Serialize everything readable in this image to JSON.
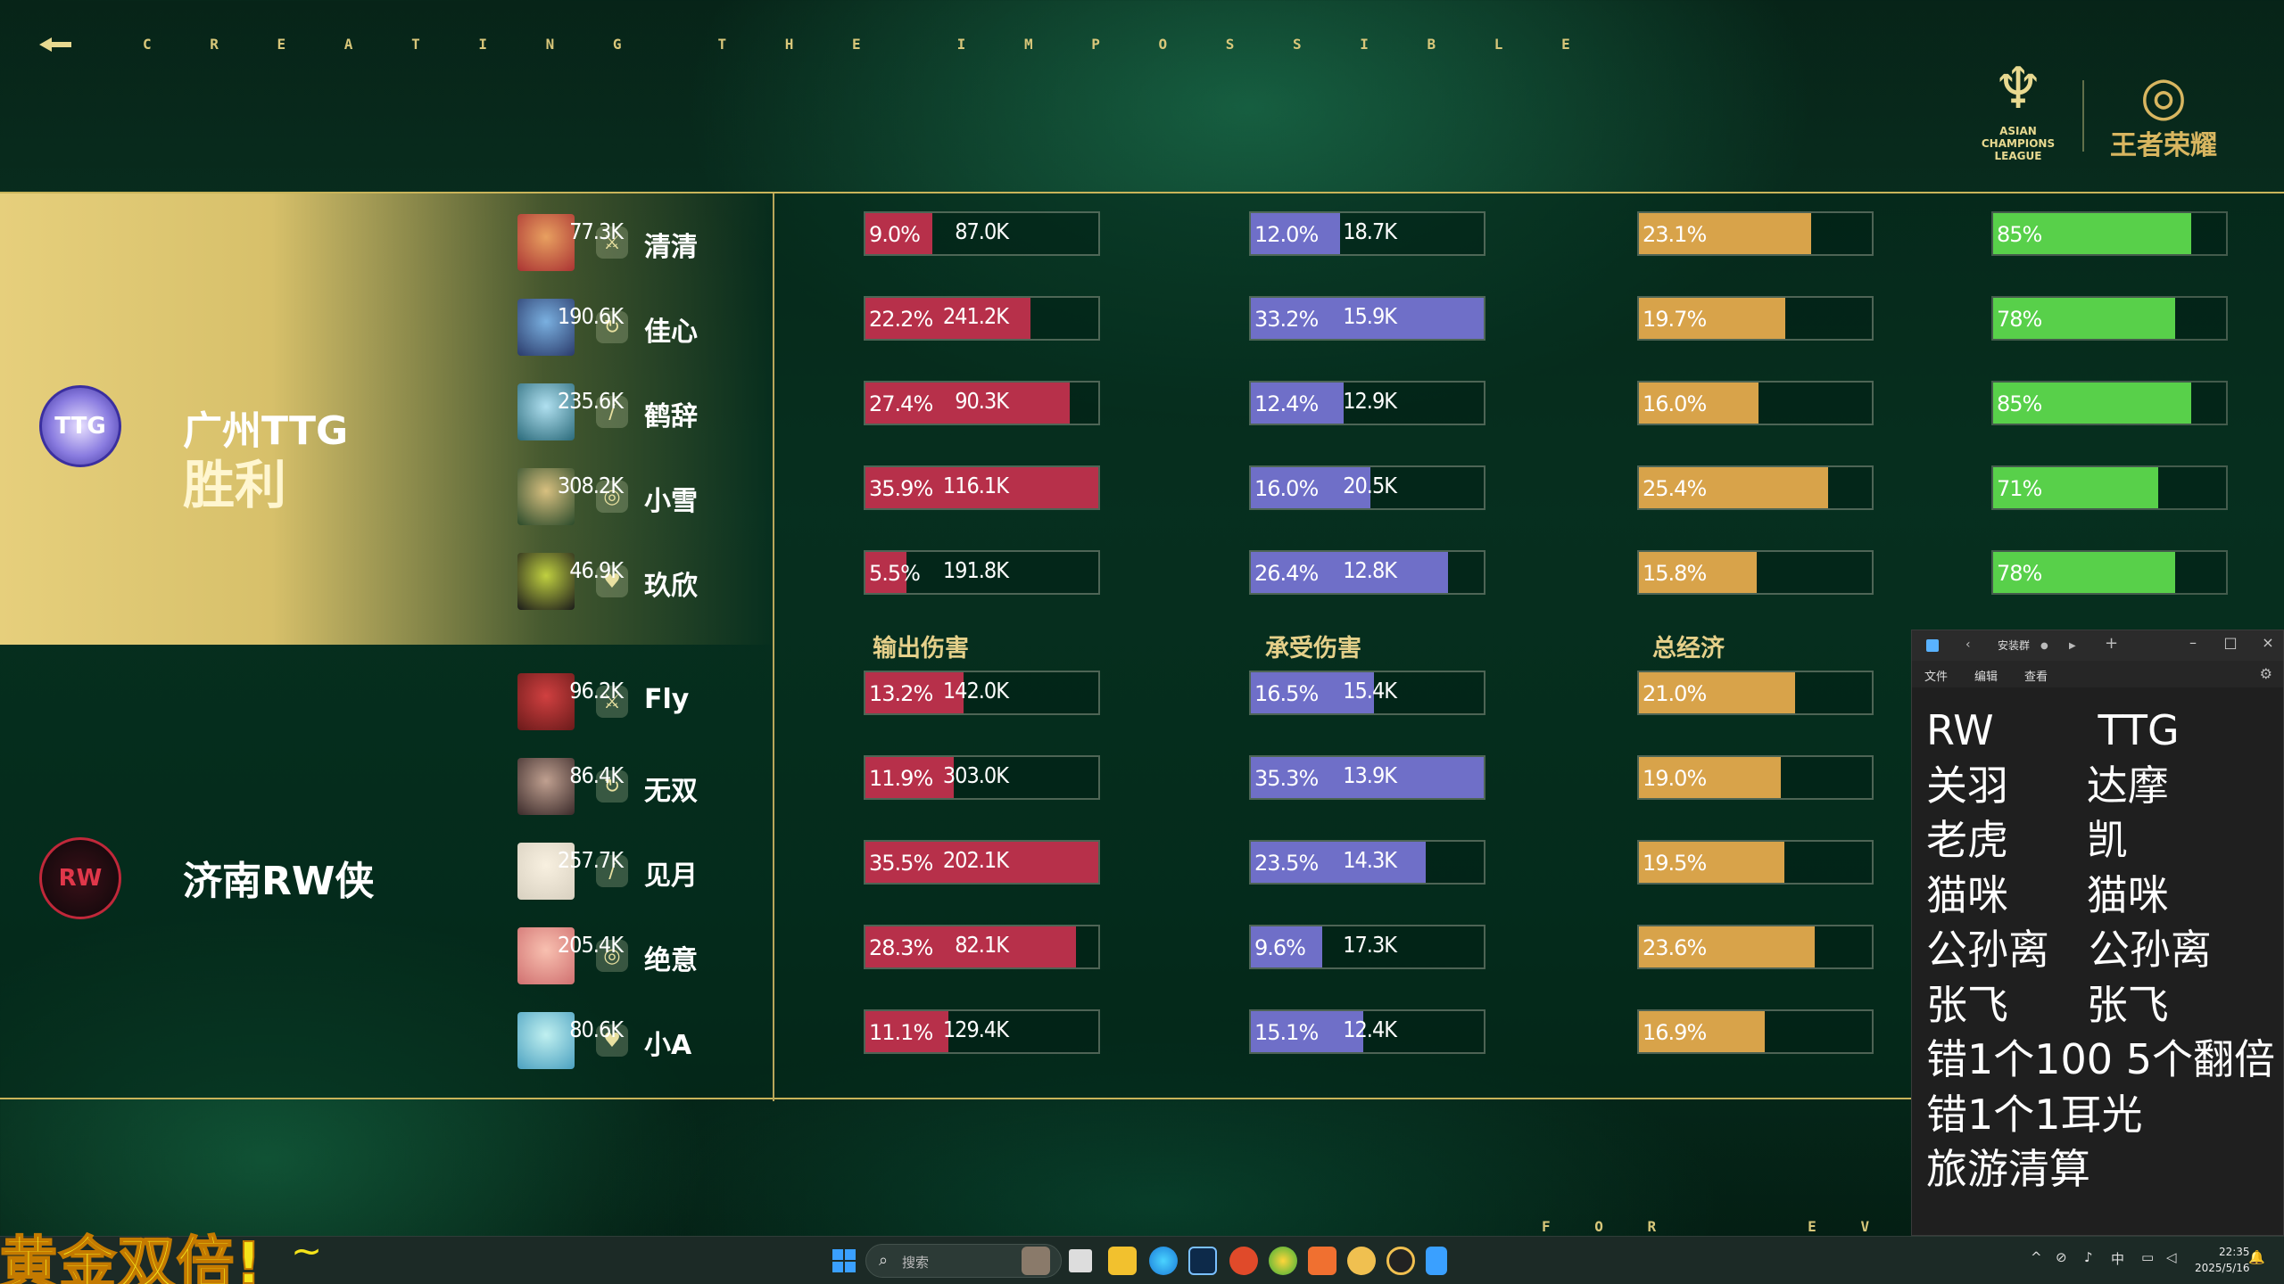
{
  "header": {
    "tagline": [
      "C R E A T I N G",
      "T H E",
      "I M P O S S I B L E"
    ],
    "league_logo_text": [
      "ASIAN",
      "CHAMPIONS",
      "LEAGUE"
    ],
    "game_logo_text": "王者荣耀"
  },
  "column_headers": {
    "damage_dealt": "输出伤害",
    "damage_taken": "承受伤害",
    "total_economy": "总经济"
  },
  "teams": [
    {
      "name": "广州TTG",
      "result": "胜利",
      "logo_text": "TTG",
      "color": "#5b4fbf",
      "players": [
        {
          "name": "清清",
          "role_icon": "jungle-icon",
          "dmg": "77.3K",
          "dmg_pct": "9.0%",
          "dmg_val": 9.0,
          "taken": "87.0K",
          "taken_pct": "12.0%",
          "taken_val": 12.0,
          "eco": "18.7K",
          "eco_pct": "23.1%",
          "eco_val": 23.1,
          "kp": "85%",
          "kp_val": 85
        },
        {
          "name": "佳心",
          "role_icon": "clash-icon",
          "dmg": "190.6K",
          "dmg_pct": "22.2%",
          "dmg_val": 22.2,
          "taken": "241.2K",
          "taken_pct": "33.2%",
          "taken_val": 33.2,
          "eco": "15.9K",
          "eco_pct": "19.7%",
          "eco_val": 19.7,
          "kp": "78%",
          "kp_val": 78
        },
        {
          "name": "鹤辞",
          "role_icon": "mid-icon",
          "dmg": "235.6K",
          "dmg_pct": "27.4%",
          "dmg_val": 27.4,
          "taken": "90.3K",
          "taken_pct": "12.4%",
          "taken_val": 12.4,
          "eco": "12.9K",
          "eco_pct": "16.0%",
          "eco_val": 16.0,
          "kp": "85%",
          "kp_val": 85
        },
        {
          "name": "小雪",
          "role_icon": "farm-icon",
          "dmg": "308.2K",
          "dmg_pct": "35.9%",
          "dmg_val": 35.9,
          "taken": "116.1K",
          "taken_pct": "16.0%",
          "taken_val": 16.0,
          "eco": "20.5K",
          "eco_pct": "25.4%",
          "eco_val": 25.4,
          "kp": "71%",
          "kp_val": 71
        },
        {
          "name": "玖欣",
          "role_icon": "support-icon",
          "dmg": "46.9K",
          "dmg_pct": "5.5%",
          "dmg_val": 5.5,
          "taken": "191.8K",
          "taken_pct": "26.4%",
          "taken_val": 26.4,
          "eco": "12.8K",
          "eco_pct": "15.8%",
          "eco_val": 15.8,
          "kp": "78%",
          "kp_val": 78
        }
      ]
    },
    {
      "name": "济南RW侠",
      "result": "",
      "logo_text": "RW",
      "color": "#c0283a",
      "players": [
        {
          "name": "Fly",
          "role_icon": "jungle-icon",
          "dmg": "96.2K",
          "dmg_pct": "13.2%",
          "dmg_val": 13.2,
          "taken": "142.0K",
          "taken_pct": "16.5%",
          "taken_val": 16.5,
          "eco": "15.4K",
          "eco_pct": "21.0%",
          "eco_val": 21.0
        },
        {
          "name": "无双",
          "role_icon": "clash-icon",
          "dmg": "86.4K",
          "dmg_pct": "11.9%",
          "dmg_val": 11.9,
          "taken": "303.0K",
          "taken_pct": "35.3%",
          "taken_val": 35.3,
          "eco": "13.9K",
          "eco_pct": "19.0%",
          "eco_val": 19.0
        },
        {
          "name": "见月",
          "role_icon": "mid-icon",
          "dmg": "257.7K",
          "dmg_pct": "35.5%",
          "dmg_val": 35.5,
          "taken": "202.1K",
          "taken_pct": "23.5%",
          "taken_val": 23.5,
          "eco": "14.3K",
          "eco_pct": "19.5%",
          "eco_val": 19.5
        },
        {
          "name": "绝意",
          "role_icon": "farm-icon",
          "dmg": "205.4K",
          "dmg_pct": "28.3%",
          "dmg_val": 28.3,
          "taken": "82.1K",
          "taken_pct": "9.6%",
          "taken_val": 9.6,
          "eco": "17.3K",
          "eco_pct": "23.6%",
          "eco_val": 23.6
        },
        {
          "name": "小A",
          "role_icon": "support-icon",
          "dmg": "80.6K",
          "dmg_pct": "11.1%",
          "dmg_val": 11.1,
          "taken": "129.4K",
          "taken_pct": "15.1%",
          "taken_val": 15.1,
          "eco": "12.4K",
          "eco_pct": "16.9%",
          "eco_val": 16.9
        }
      ]
    }
  ],
  "footer": {
    "tagline": [
      "F O R",
      "E V E R"
    ]
  },
  "notepad": {
    "tab_title": "安装群",
    "menu": [
      "文件",
      "编辑",
      "查看"
    ],
    "lines": [
      "RW        TTG",
      "关羽      达摩",
      "老虎      凯",
      "猫咪      猫咪",
      "公孙离   公孙离",
      "张飞      张飞",
      "错1个100 5个翻倍",
      "错1个1耳光",
      "旅游清算"
    ]
  },
  "overlay": {
    "text": "黄金双倍!",
    "tilde": "~"
  },
  "taskbar": {
    "search_placeholder": "搜索",
    "time": "22:35",
    "date": "2025/5/16"
  },
  "colors": {
    "damage": "#b7304a",
    "taken": "#6f6fc8",
    "economy": "#d8a34a",
    "kill_participation": "#58d04a",
    "gold": "#c9b45a"
  }
}
